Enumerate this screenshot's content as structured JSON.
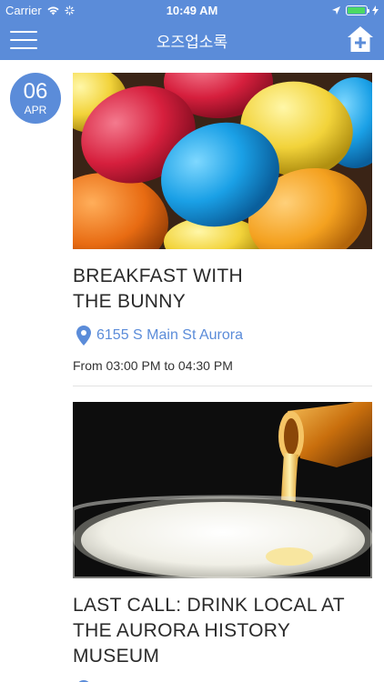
{
  "status_bar": {
    "carrier": "Carrier",
    "time": "10:49 AM",
    "battery_level": 0.95
  },
  "navbar": {
    "title": "오즈업소록",
    "menu_icon": "hamburger-menu-icon",
    "home_icon": "home-plus-icon"
  },
  "events": [
    {
      "day": "06",
      "month": "APR",
      "title_line1": "BREAKFAST WITH",
      "title_line2": "THE BUNNY",
      "location": "6155 S Main St Aurora",
      "time": "From 03:00 PM to 04:30 PM",
      "image": "colorful-easter-eggs-photo"
    },
    {
      "title_line1": "LAST CALL: DRINK LOCAL AT",
      "title_line2": "THE AURORA HISTORY",
      "title_line3": "MUSEUM",
      "image": "beer-pouring-into-glass-photo"
    }
  ],
  "colors": {
    "accent": "#5b8cd9",
    "text": "#2a2a2a",
    "divider": "#e2e2e2"
  }
}
